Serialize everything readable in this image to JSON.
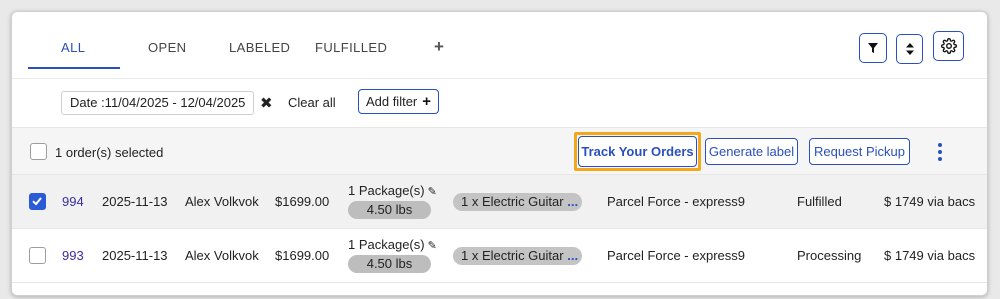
{
  "tabs": [
    {
      "label": "ALL",
      "active": true
    },
    {
      "label": "OPEN",
      "active": false
    },
    {
      "label": "LABELED",
      "active": false
    },
    {
      "label": "FULFILLED",
      "active": false
    }
  ],
  "tab_add_symbol": "+",
  "toolbar_icons": [
    "filter-icon",
    "sort-icon",
    "gear-icon"
  ],
  "filters": {
    "date_chip": "Date :11/04/2025 - 12/04/2025",
    "clear_symbol": "✖",
    "clear_all": "Clear all",
    "add_filter": "Add filter",
    "add_filter_symbol": "+"
  },
  "selection": {
    "text": "1 order(s) selected"
  },
  "actions": {
    "track_orders": "Track Your Orders",
    "generate_label": "Generate label",
    "request_pickup": "Request Pickup"
  },
  "highlight_color": "#f3a81c",
  "accent_color": "#2a4fbf",
  "orders": [
    {
      "checked": true,
      "id": "994",
      "date": "2025-11-13",
      "customer": "Alex Volkvok",
      "amount": "$1699.00",
      "packages": "1 Package(s)",
      "weight": "4.50 lbs",
      "items": "1 x Electric Guitar",
      "items_more": "...",
      "carrier": "Parcel Force - express9",
      "status": "Fulfilled",
      "payment": "$ 1749 via bacs"
    },
    {
      "checked": false,
      "id": "993",
      "date": "2025-11-13",
      "customer": "Alex Volkvok",
      "amount": "$1699.00",
      "packages": "1 Package(s)",
      "weight": "4.50 lbs",
      "items": "1 x Electric Guitar",
      "items_more": "...",
      "carrier": "Parcel Force - express9",
      "status": "Processing",
      "payment": "$ 1749 via bacs"
    }
  ]
}
